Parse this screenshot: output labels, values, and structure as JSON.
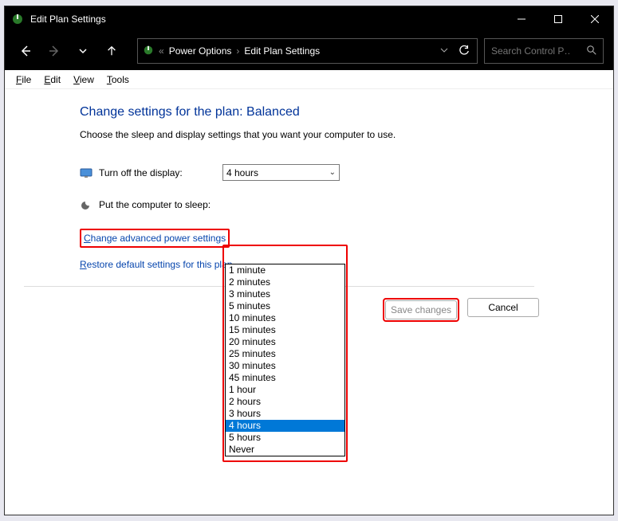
{
  "window": {
    "title": "Edit Plan Settings"
  },
  "breadcrumb": {
    "prefix": "«",
    "item1": "Power Options",
    "item2": "Edit Plan Settings"
  },
  "search": {
    "placeholder": "Search Control P…"
  },
  "menu": {
    "file": "File",
    "edit": "Edit",
    "view": "View",
    "tools": "Tools"
  },
  "page": {
    "heading": "Change settings for the plan: Balanced",
    "subtext": "Choose the sleep and display settings that you want your computer to use."
  },
  "settings": {
    "display_label": "Turn off the display:",
    "sleep_label": "Put the computer to sleep:",
    "display_value": "4 hours"
  },
  "dropdown_options": [
    "1 minute",
    "2 minutes",
    "3 minutes",
    "5 minutes",
    "10 minutes",
    "15 minutes",
    "20 minutes",
    "25 minutes",
    "30 minutes",
    "45 minutes",
    "1 hour",
    "2 hours",
    "3 hours",
    "4 hours",
    "5 hours",
    "Never"
  ],
  "dropdown_selected": "4 hours",
  "links": {
    "advanced": "Change advanced power settings",
    "restore": "Restore default settings for this plan"
  },
  "buttons": {
    "save": "Save changes",
    "cancel": "Cancel"
  }
}
